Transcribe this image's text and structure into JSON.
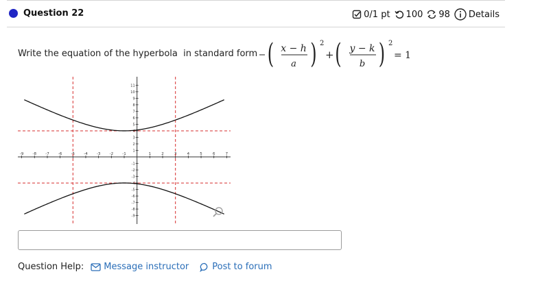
{
  "question": {
    "title": "Question 22",
    "score": "0/1 pt",
    "retries": "100",
    "attempts": "98",
    "details_label": "Details"
  },
  "prompt": "Write the equation of the hyperbola  in standard form",
  "formula": {
    "num1": "x − h",
    "den1": "a",
    "num2": "y − k",
    "den2": "b",
    "exp": "2",
    "rhs": "= 1"
  },
  "graph": {
    "x_ticks": [
      "-9",
      "-8",
      "-7",
      "-6",
      "-5",
      "-4",
      "-3",
      "-2",
      "-1",
      "1",
      "2",
      "3",
      "4",
      "5",
      "6",
      "7"
    ],
    "y_ticks": [
      "11",
      "10",
      "9",
      "8",
      "7",
      "6",
      "5",
      "4",
      "3",
      "2",
      "1",
      "-1",
      "-2",
      "-3",
      "-4",
      "-5",
      "-6",
      "-7",
      "-8",
      "-9"
    ],
    "center": [
      -1,
      0
    ],
    "vertices_y": [
      4,
      -4
    ],
    "asymptote_box_x": [
      -5,
      3
    ],
    "zoom_icon": "magnify-icon"
  },
  "answer": {
    "value": "",
    "placeholder": ""
  },
  "help": {
    "label": "Question Help:",
    "message_link": "Message instructor",
    "forum_link": "Post to forum"
  },
  "colors": {
    "accent_blue": "#1f25c4",
    "link_blue": "#2a6eb8",
    "dashed_red": "#d62c2c"
  }
}
